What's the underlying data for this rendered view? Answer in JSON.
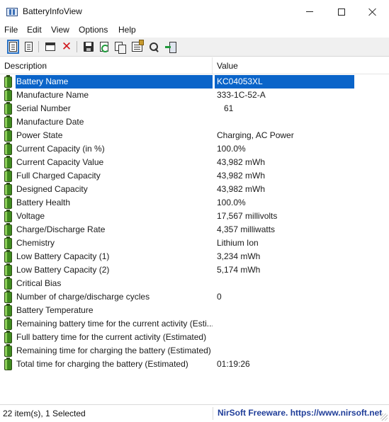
{
  "window": {
    "title": "BatteryInfoView"
  },
  "menu": [
    "File",
    "Edit",
    "View",
    "Options",
    "Help"
  ],
  "toolbar": {
    "icons": [
      "html-report-all-icon",
      "html-report-selected-icon",
      "window-icon",
      "delete-icon",
      "save-icon",
      "refresh-icon",
      "copy-icon",
      "properties-icon",
      "find-icon",
      "exit-icon"
    ]
  },
  "columns": {
    "description": "Description",
    "value": "Value"
  },
  "rows": [
    {
      "description": "Battery Name",
      "value": "KC04053XL"
    },
    {
      "description": "Manufacture Name",
      "value": "333-1C-52-A"
    },
    {
      "description": "Serial Number",
      "value": "   61"
    },
    {
      "description": "Manufacture Date",
      "value": ""
    },
    {
      "description": "Power State",
      "value": "Charging, AC Power"
    },
    {
      "description": "Current Capacity (in %)",
      "value": "100.0%"
    },
    {
      "description": "Current Capacity Value",
      "value": "43,982 mWh"
    },
    {
      "description": "Full Charged Capacity",
      "value": "43,982 mWh"
    },
    {
      "description": "Designed Capacity",
      "value": "43,982 mWh"
    },
    {
      "description": "Battery Health",
      "value": "100.0%"
    },
    {
      "description": "Voltage",
      "value": "17,567 millivolts"
    },
    {
      "description": "Charge/Discharge Rate",
      "value": "4,357 milliwatts"
    },
    {
      "description": "Chemistry",
      "value": "Lithium Ion"
    },
    {
      "description": "Low Battery Capacity (1)",
      "value": "3,234 mWh"
    },
    {
      "description": "Low Battery Capacity (2)",
      "value": "5,174 mWh"
    },
    {
      "description": "Critical Bias",
      "value": ""
    },
    {
      "description": "Number of charge/discharge cycles",
      "value": "0"
    },
    {
      "description": "Battery Temperature",
      "value": ""
    },
    {
      "description": "Remaining battery time for the current activity (Esti...",
      "value": ""
    },
    {
      "description": "Full battery time for the current activity (Estimated)",
      "value": ""
    },
    {
      "description": "Remaining time for charging the battery (Estimated)",
      "value": ""
    },
    {
      "description": "Total  time for charging the battery (Estimated)",
      "value": "01:19:26"
    }
  ],
  "selected_row": 0,
  "status": {
    "items": "22 item(s), 1 Selected",
    "link": "NirSoft Freeware. https://www.nirsoft.net"
  },
  "colors": {
    "selection": "#0a64c9",
    "link": "#1f3d99",
    "battery_icon": "#3f8a1f"
  }
}
